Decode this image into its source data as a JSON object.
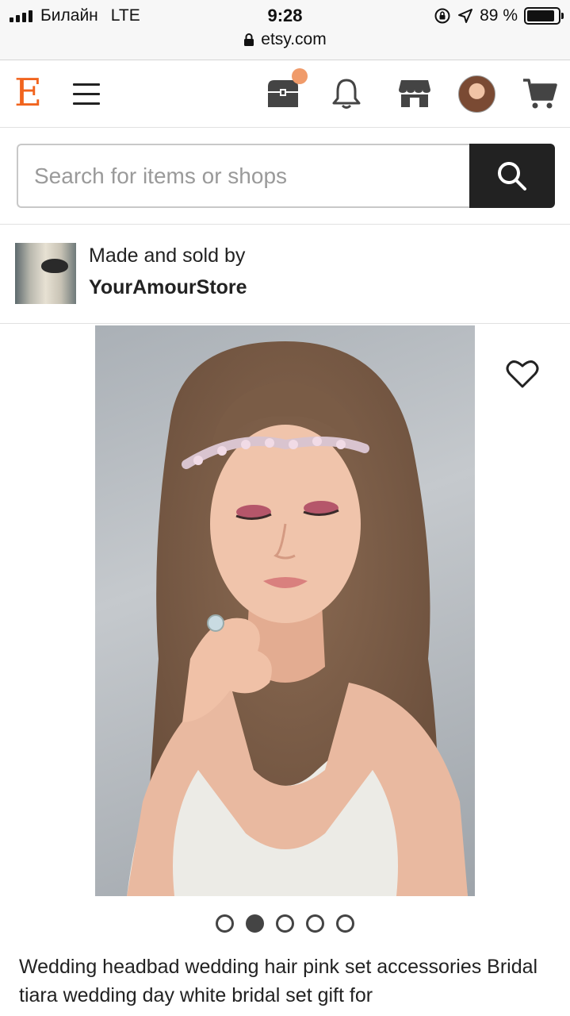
{
  "status_bar": {
    "carrier": "Билайн",
    "network": "LTE",
    "time": "9:28",
    "battery_text": "89 %",
    "battery_level": 0.89,
    "url": "etsy.com"
  },
  "header": {
    "logo": "E",
    "notification_dot_color": "#f09b6a"
  },
  "search": {
    "placeholder": "Search for items or shops"
  },
  "seller": {
    "made_by_label": "Made and sold by",
    "shop_name": "YourAmourStore"
  },
  "gallery": {
    "image_count": 5,
    "active_index": 1
  },
  "listing": {
    "title": "Wedding headbad wedding hair pink set accessories Bridal tiara wedding day white bridal set gift for"
  },
  "colors": {
    "brand": "#f1641e",
    "search_button": "#222222"
  }
}
